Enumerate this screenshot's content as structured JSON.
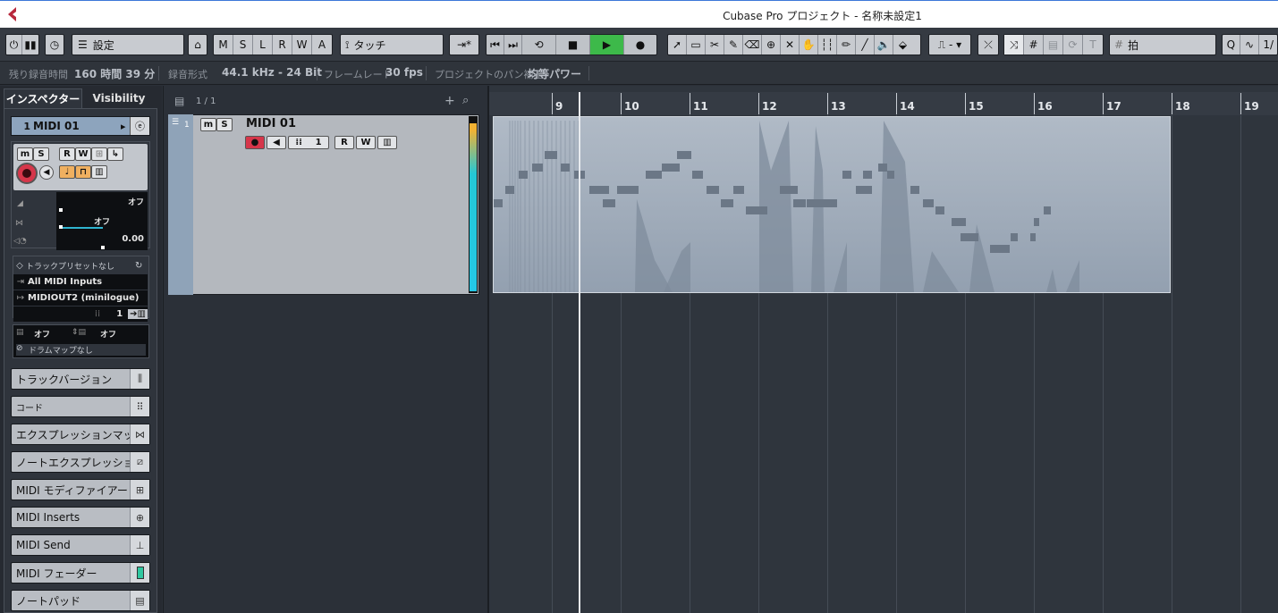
{
  "window": {
    "title": "Cubase Pro プロジェクト - 名称未設定1"
  },
  "toolbar": {
    "preset_label": "設定",
    "msrwa": [
      "M",
      "S",
      "L",
      "R",
      "W",
      "A"
    ],
    "automation_mode": "タッチ",
    "quantize_label": "拍",
    "q_label": "Q",
    "fraction_label": "1/"
  },
  "infobar": {
    "rec_time_label": "残り録音時間",
    "rec_time_value": "160 時間 39 分",
    "rec_format_label": "録音形式",
    "rec_format_value": "44.1 kHz - 24 Bit",
    "framerate_label": "フレームレート",
    "framerate_value": "30 fps",
    "pan_label": "プロジェクトのパン補正",
    "pan_value": "均等パワー"
  },
  "inspector": {
    "tabs": [
      "インスペクター",
      "Visibility"
    ],
    "track_number": "1",
    "track_name": "MIDI 01",
    "volume_value": "オフ",
    "pan_value": "オフ",
    "delay_value": "0.00",
    "track_preset": "トラックプリセットなし",
    "input": "All MIDI Inputs",
    "output": "MIDIOUT2 (minilogue)",
    "channel": "1",
    "bank_value": "オフ",
    "program_value": "オフ",
    "drum_map": "ドラムマップなし",
    "sections": [
      {
        "label": "トラックバージョン",
        "icon": "versions-icon"
      },
      {
        "label": "コード",
        "icon": "chord-icon"
      },
      {
        "label": "エクスプレッションマップ",
        "icon": "expression-map-icon"
      },
      {
        "label": "ノートエクスプレッション",
        "icon": "note-expression-icon"
      },
      {
        "label": "MIDI モディファイアー",
        "icon": "modifier-icon"
      },
      {
        "label": "MIDI Inserts",
        "icon": "inserts-icon"
      },
      {
        "label": "MIDI Send",
        "icon": "send-icon"
      },
      {
        "label": "MIDI フェーダー",
        "icon": "fader-icon"
      },
      {
        "label": "ノートパッド",
        "icon": "notepad-icon"
      }
    ]
  },
  "tracklist": {
    "track_count": "1 / 1",
    "track": {
      "number": "1",
      "name": "MIDI 01",
      "channel": "1"
    }
  },
  "ruler": {
    "bars": [
      "9",
      "10",
      "11",
      "12",
      "13",
      "14",
      "15",
      "16",
      "17",
      "18",
      "19"
    ]
  },
  "colors": {
    "accent_green": "#3db94a",
    "record_red": "#d6364a",
    "part_blue": "#a9b5c2"
  }
}
